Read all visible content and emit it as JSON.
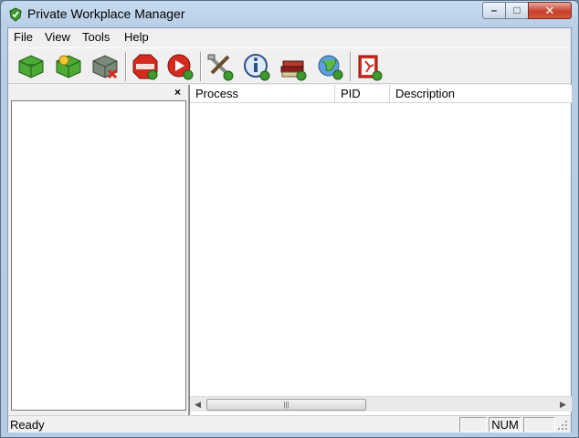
{
  "window": {
    "title": "Private Workplace Manager",
    "app_icon": "green-shield-icon"
  },
  "title_controls": {
    "minimize": "minimize-icon",
    "maximize": "maximize-icon",
    "close": "close-icon"
  },
  "menu": [
    "File",
    "View",
    "Tools",
    "Help"
  ],
  "toolbar": {
    "buttons": [
      {
        "icon": "green-box-check-icon"
      },
      {
        "icon": "green-box-add-icon"
      },
      {
        "icon": "gray-box-delete-icon"
      },
      {
        "icon": "stop-icon"
      },
      {
        "icon": "play-red-icon"
      },
      {
        "icon": "tools-icon"
      },
      {
        "icon": "info-icon"
      },
      {
        "icon": "books-icon"
      },
      {
        "icon": "globe-icon"
      },
      {
        "icon": "exit-icon"
      }
    ]
  },
  "left_pane": {
    "close_label": "×"
  },
  "list": {
    "columns": [
      "Process",
      "PID",
      "Description"
    ],
    "rows": []
  },
  "scrollbar": {
    "thumb_grip": "|||"
  },
  "status": {
    "text": "Ready",
    "indicators": [
      "",
      "NUM",
      ""
    ]
  },
  "colors": {
    "accent_green": "#3f9a2e",
    "stop_red": "#d42b1e"
  }
}
